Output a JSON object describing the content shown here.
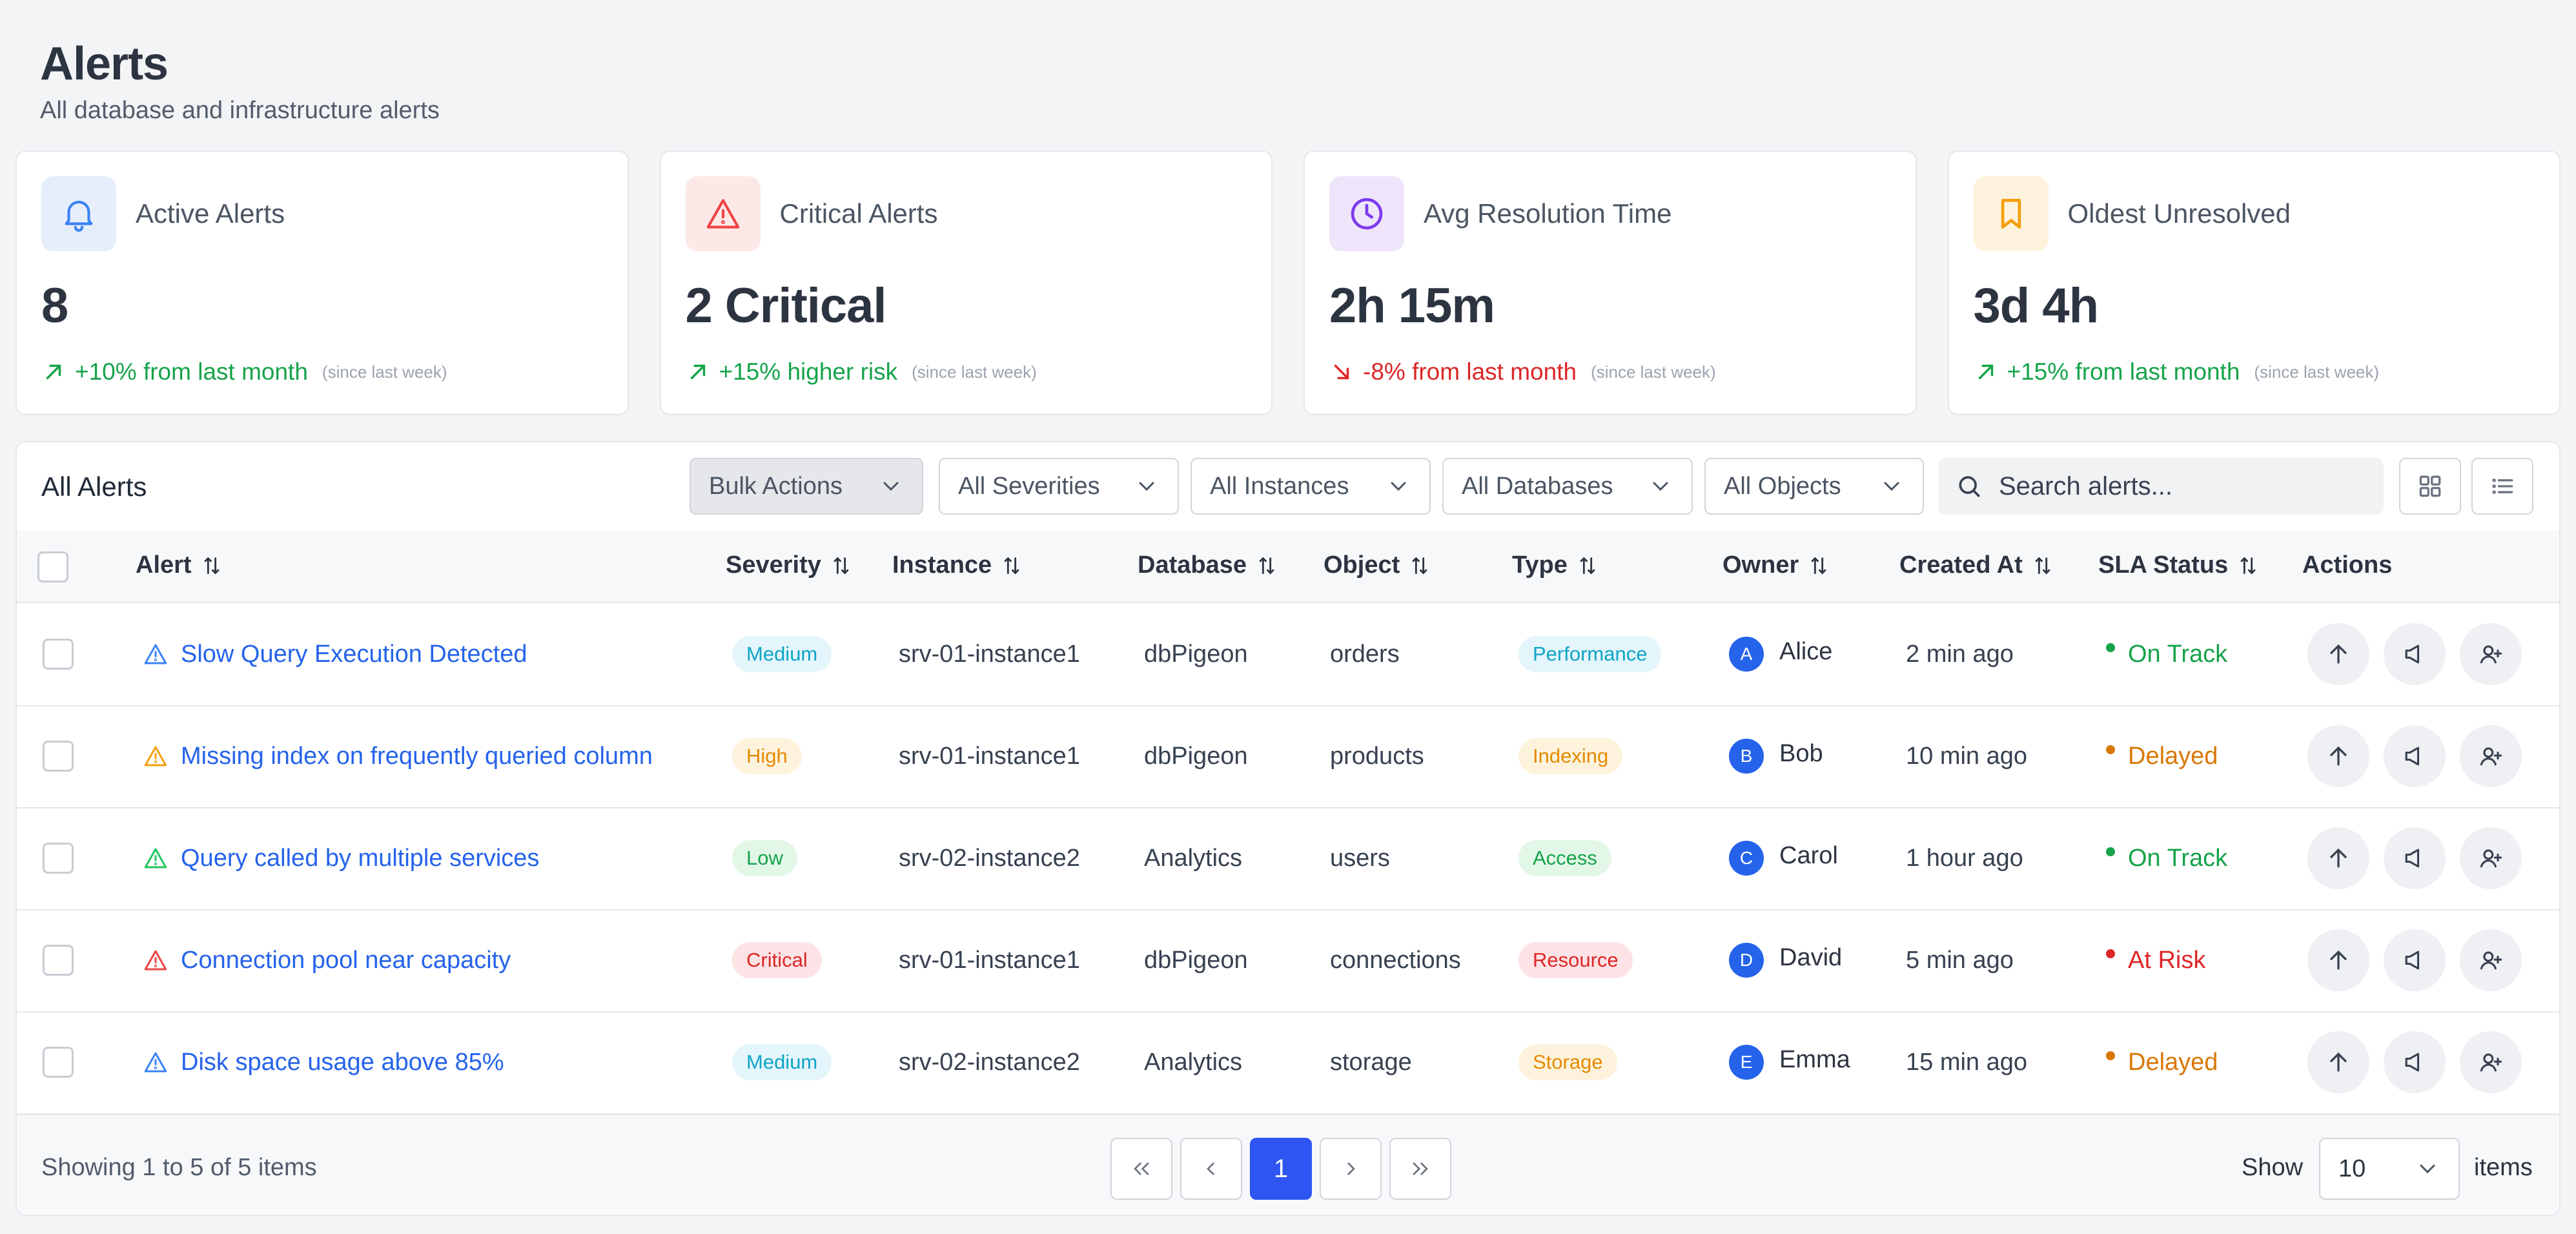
{
  "header": {
    "title": "Alerts",
    "subtitle": "All database and infrastructure alerts"
  },
  "stats": [
    {
      "label": "Active Alerts",
      "value": "8",
      "trend": "+10% from last month",
      "direction": "up",
      "since": "(since last week)",
      "icon": "bell-icon",
      "icon_bg": "#e6eefb",
      "icon_color": "#3b82f6"
    },
    {
      "label": "Critical Alerts",
      "value": "2 Critical",
      "trend": "+15% higher risk",
      "direction": "up",
      "since": "(since last week)",
      "icon": "warning-icon",
      "icon_bg": "#fde8e8",
      "icon_color": "#ef4444"
    },
    {
      "label": "Avg Resolution Time",
      "value": "2h 15m",
      "trend": "-8% from last month",
      "direction": "down",
      "since": "(since last week)",
      "icon": "clock-icon",
      "icon_bg": "#efe5fb",
      "icon_color": "#7c3aed"
    },
    {
      "label": "Oldest Unresolved",
      "value": "3d 4h",
      "trend": "+15% from last month",
      "direction": "up",
      "since": "(since last week)",
      "icon": "bookmark-icon",
      "icon_bg": "#fdf3dd",
      "icon_color": "#f59e0b"
    }
  ],
  "toolbar": {
    "title": "All Alerts",
    "bulk_actions": "Bulk Actions",
    "severity_filter": "All Severities",
    "instance_filter": "All Instances",
    "database_filter": "All Databases",
    "object_filter": "All Objects",
    "search_placeholder": "Search alerts..."
  },
  "columns": {
    "alert": "Alert",
    "severity": "Severity",
    "instance": "Instance",
    "database": "Database",
    "object": "Object",
    "type": "Type",
    "owner": "Owner",
    "created_at": "Created At",
    "sla_status": "SLA Status",
    "actions": "Actions"
  },
  "rows": [
    {
      "alert": "Slow Query Execution Detected",
      "alert_icon_color": "#3b82f6",
      "severity": "Medium",
      "instance": "srv-01-instance1",
      "database": "dbPigeon",
      "object": "orders",
      "type": "Performance",
      "owner_initial": "A",
      "owner": "Alice",
      "created_at": "2 min ago",
      "sla": "On Track"
    },
    {
      "alert": "Missing index on frequently queried column",
      "alert_icon_color": "#f59e0b",
      "severity": "High",
      "instance": "srv-01-instance1",
      "database": "dbPigeon",
      "object": "products",
      "type": "Indexing",
      "owner_initial": "B",
      "owner": "Bob",
      "created_at": "10 min ago",
      "sla": "Delayed"
    },
    {
      "alert": "Query called by multiple services",
      "alert_icon_color": "#22c55e",
      "severity": "Low",
      "instance": "srv-02-instance2",
      "database": "Analytics",
      "object": "users",
      "type": "Access",
      "owner_initial": "C",
      "owner": "Carol",
      "created_at": "1 hour ago",
      "sla": "On Track"
    },
    {
      "alert": "Connection pool near capacity",
      "alert_icon_color": "#ef4444",
      "severity": "Critical",
      "instance": "srv-01-instance1",
      "database": "dbPigeon",
      "object": "connections",
      "type": "Resource",
      "owner_initial": "D",
      "owner": "David",
      "created_at": "5 min ago",
      "sla": "At Risk"
    },
    {
      "alert": "Disk space usage above 85%",
      "alert_icon_color": "#3b82f6",
      "severity": "Medium",
      "instance": "srv-02-instance2",
      "database": "Analytics",
      "object": "storage",
      "type": "Storage",
      "owner_initial": "E",
      "owner": "Emma",
      "created_at": "15 min ago",
      "sla": "Delayed"
    }
  ],
  "badge_styles": {
    "Medium": {
      "bg": "#e4f5fb",
      "fg": "#0ea5c6"
    },
    "High": {
      "bg": "#fdf3dd",
      "fg": "#e58a00"
    },
    "Low": {
      "bg": "#e3f7e8",
      "fg": "#16a34a"
    },
    "Critical": {
      "bg": "#fde3e5",
      "fg": "#dc2626"
    },
    "Performance": {
      "bg": "#e4f5fb",
      "fg": "#0ea5c6"
    },
    "Indexing": {
      "bg": "#fdf3dd",
      "fg": "#e58a00"
    },
    "Access": {
      "bg": "#e3f7e8",
      "fg": "#16a34a"
    },
    "Resource": {
      "bg": "#fde3e5",
      "fg": "#dc2626"
    },
    "Storage": {
      "bg": "#fdf3dd",
      "fg": "#e58a00"
    }
  },
  "sla_colors": {
    "On Track": "#16a34a",
    "Delayed": "#d97706",
    "At Risk": "#dc2626"
  },
  "footer": {
    "showing": "Showing 1 to 5 of 5 items",
    "current_page": "1",
    "show_label": "Show",
    "page_size": "10",
    "items_label": "items"
  }
}
